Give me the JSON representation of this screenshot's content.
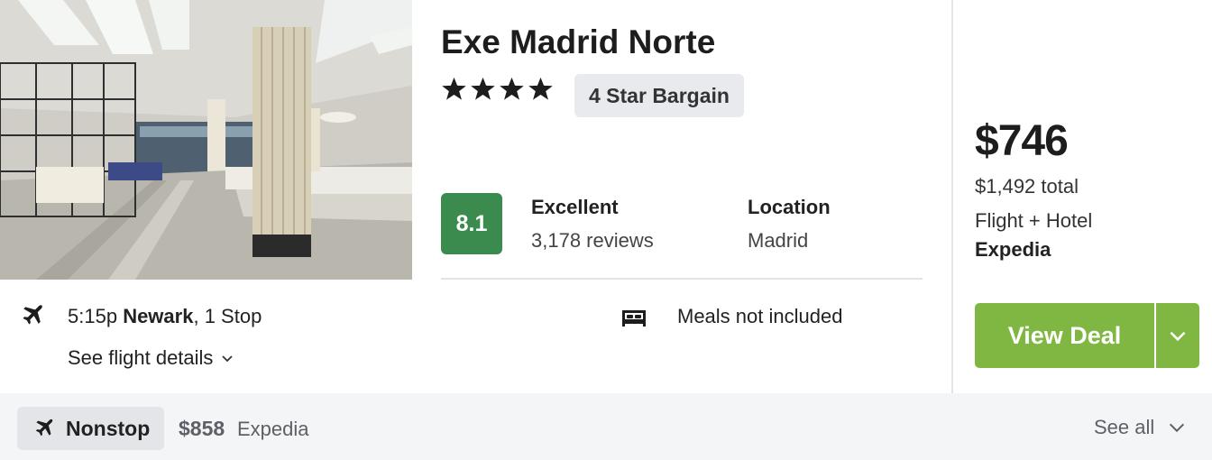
{
  "hotel": {
    "name": "Exe Madrid Norte",
    "star_count": 4,
    "badge": "4 Star Bargain",
    "score": "8.1",
    "rating_word": "Excellent",
    "reviews": "3,178 reviews",
    "location_label": "Location",
    "location_value": "Madrid",
    "photo_icon": "hotel-lobby-photo"
  },
  "flight": {
    "time": "5:15p",
    "airport": "Newark",
    "stops": ", 1 Stop",
    "details_link": "See flight details",
    "icon": "plane-icon"
  },
  "amenity": {
    "meals": "Meals not included",
    "icon": "bed-icon"
  },
  "deal": {
    "price": "$746",
    "total": "$1,492 total",
    "package": "Flight + Hotel",
    "provider": "Expedia",
    "button_label": "View Deal",
    "accent": "#7fb742"
  },
  "alt": {
    "filter_label": "Nonstop",
    "price": "$858",
    "provider": "Expedia",
    "see_all": "See all"
  },
  "colors": {
    "score_bg": "#3b8b4f",
    "strip_bg": "#f4f5f7"
  }
}
